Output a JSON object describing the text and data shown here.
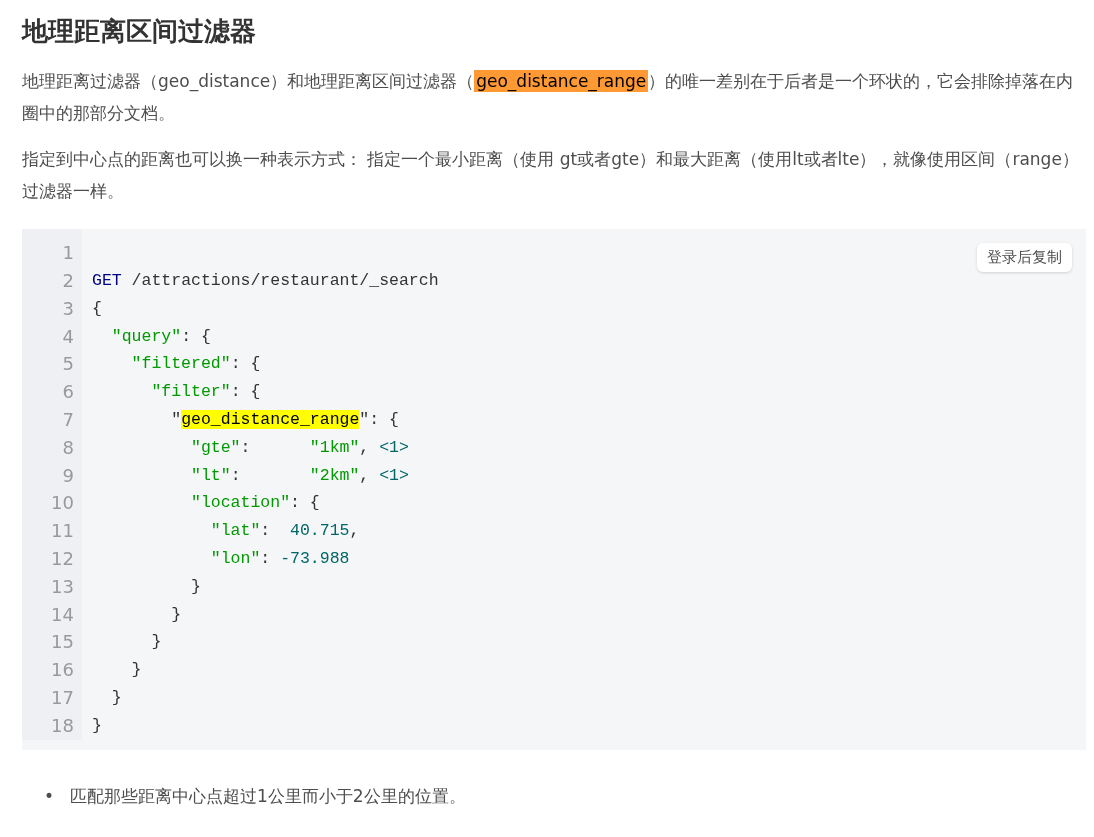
{
  "heading": "地理距离区间过滤器",
  "paragraphs": [
    {
      "segments": [
        {
          "text": "地理距离过滤器（geo_distance）和地理距离区间过滤器（",
          "highlighted": false
        },
        {
          "text": "geo_distance_range",
          "highlighted": true
        },
        {
          "text": "）的唯一差别在于后者是一个环状的，它会排除掉落在内圈中的那部分文档。",
          "highlighted": false
        }
      ]
    },
    {
      "segments": [
        {
          "text": "指定到中心点的距离也可以换一种表示方式： 指定一个最小距离（使用 gt或者gte）和最大距离（使用lt或者lte），就像使用区间（range）过滤器一样。",
          "highlighted": false
        }
      ]
    }
  ],
  "code_block": {
    "copy_button": "登录后复制",
    "line_numbers": [
      "1",
      "2",
      "3",
      "4",
      "5",
      "6",
      "7",
      "8",
      "9",
      "10",
      "11",
      "12",
      "13",
      "14",
      "15",
      "16",
      "17",
      "18"
    ],
    "lines": [
      {
        "tokens": [
          {
            "kind": "keyword",
            "text": "GET"
          },
          {
            "kind": "plain",
            "text": " /attractions/restaurant/_search"
          }
        ]
      },
      {
        "tokens": [
          {
            "kind": "plain",
            "text": "{"
          }
        ]
      },
      {
        "tokens": [
          {
            "kind": "key",
            "text": "  \"query\""
          },
          {
            "kind": "plain",
            "text": ": {"
          }
        ]
      },
      {
        "tokens": [
          {
            "kind": "key",
            "text": "    \"filtered\""
          },
          {
            "kind": "plain",
            "text": ": {"
          }
        ]
      },
      {
        "tokens": [
          {
            "kind": "key",
            "text": "      \"filter\""
          },
          {
            "kind": "plain",
            "text": ": {"
          }
        ]
      },
      {
        "tokens": [
          {
            "kind": "plain",
            "text": "        \""
          },
          {
            "kind": "highlight",
            "text": "geo_distance_range"
          },
          {
            "kind": "plain",
            "text": "\": {"
          }
        ]
      },
      {
        "tokens": [
          {
            "kind": "key",
            "text": "          \"gte\""
          },
          {
            "kind": "plain",
            "text": ":      "
          },
          {
            "kind": "key",
            "text": "\"1km\""
          },
          {
            "kind": "plain",
            "text": ", "
          },
          {
            "kind": "number",
            "text": "<1>"
          }
        ]
      },
      {
        "tokens": [
          {
            "kind": "key",
            "text": "          \"lt\""
          },
          {
            "kind": "plain",
            "text": ":       "
          },
          {
            "kind": "key",
            "text": "\"2km\""
          },
          {
            "kind": "plain",
            "text": ", "
          },
          {
            "kind": "number",
            "text": "<1>"
          }
        ]
      },
      {
        "tokens": [
          {
            "kind": "key",
            "text": "          \"location\""
          },
          {
            "kind": "plain",
            "text": ": {"
          }
        ]
      },
      {
        "tokens": [
          {
            "kind": "key",
            "text": "            \"lat\""
          },
          {
            "kind": "plain",
            "text": ":  "
          },
          {
            "kind": "number",
            "text": "40.715"
          },
          {
            "kind": "plain",
            "text": ","
          }
        ]
      },
      {
        "tokens": [
          {
            "kind": "key",
            "text": "            \"lon\""
          },
          {
            "kind": "plain",
            "text": ": "
          },
          {
            "kind": "number",
            "text": "-73.988"
          }
        ]
      },
      {
        "tokens": [
          {
            "kind": "plain",
            "text": "          }"
          }
        ]
      },
      {
        "tokens": [
          {
            "kind": "plain",
            "text": "        }"
          }
        ]
      },
      {
        "tokens": [
          {
            "kind": "plain",
            "text": "      }"
          }
        ]
      },
      {
        "tokens": [
          {
            "kind": "plain",
            "text": "    }"
          }
        ]
      },
      {
        "tokens": [
          {
            "kind": "plain",
            "text": "  }"
          }
        ]
      },
      {
        "tokens": [
          {
            "kind": "plain",
            "text": "}"
          }
        ]
      }
    ]
  },
  "bullets": [
    {
      "marker": "•",
      "text": "匹配那些距离中心点超过1公里而小于2公里的位置。"
    }
  ]
}
